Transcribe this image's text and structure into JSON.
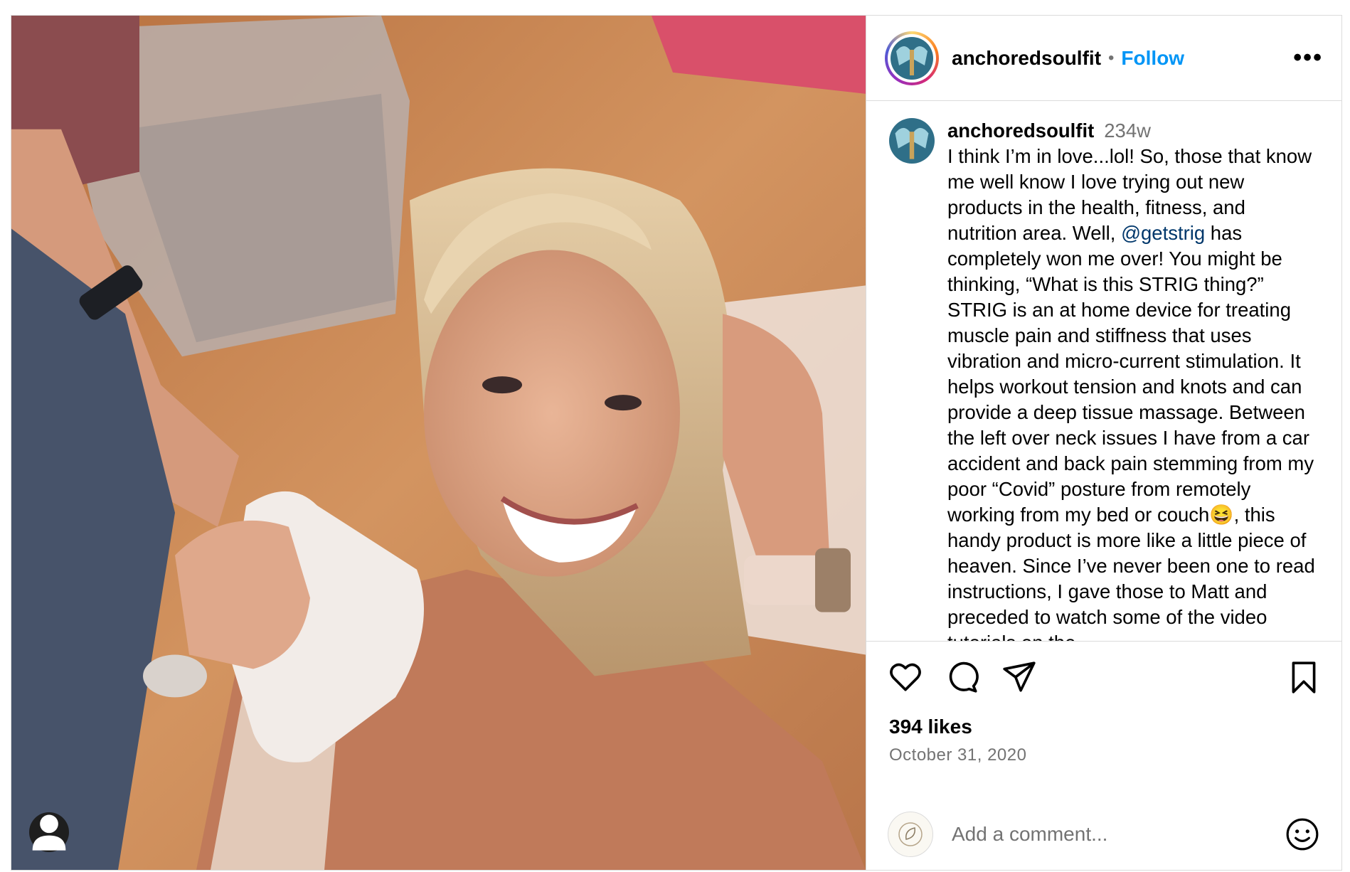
{
  "post": {
    "username": "anchoredsoulfit",
    "separator": "•",
    "follow_label": "Follow",
    "more_label": "•••",
    "caption": {
      "username": "anchoredsoulfit",
      "time": "234w",
      "text_before_mention": "I think I’m in love...lol! So, those that know me well know I love trying out new products in the health, fitness, and nutrition area. Well, ",
      "mention": "@getstrig",
      "text_after_mention": " has completely won me over! You might be thinking, “What is this STRIG thing?” STRIG is an at home device for treating muscle pain and stiffness that uses vibration and micro-current stimulation. It helps workout tension and knots and can provide a deep tissue massage. Between the left over neck issues I have from a car accident and back pain stemming from my poor “Covid” posture from remotely working from my bed or couch😆, this handy product is more like a little piece of heaven. Since I’ve never been one to read instructions, I gave those to Matt and preceded to watch some of the video tutorials on the"
    },
    "likes": "394 likes",
    "date": "October 31, 2020",
    "comment_placeholder": "Add a comment...",
    "icons": {
      "like": "heart-icon",
      "comment": "comment-icon",
      "share": "paper-plane-icon",
      "save": "bookmark-icon",
      "emoji": "smiley-icon",
      "tag": "user-tag-icon"
    }
  }
}
